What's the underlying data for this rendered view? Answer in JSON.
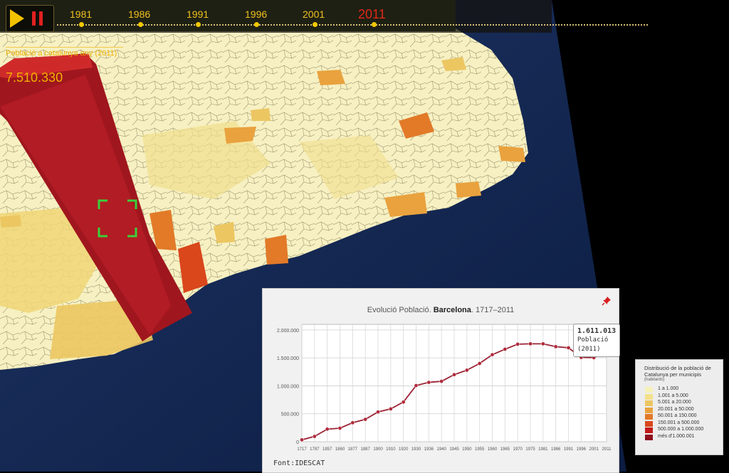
{
  "timeline": {
    "years": [
      "1981",
      "1986",
      "1991",
      "1996",
      "2001",
      "2011"
    ],
    "active_year": "2011"
  },
  "map": {
    "subtitle": "Població a catalunya any (2011)",
    "highlight_value": "7.510.330"
  },
  "chart_panel": {
    "title_prefix": "Evolució Població.",
    "title_bold": "Barcelona",
    "title_suffix": ". 1717–2011",
    "source": "Font:IDESCAT",
    "tooltip": {
      "value": "1.611.013",
      "label": "Població (2011)"
    }
  },
  "chart_data": {
    "type": "line",
    "title": "Evolució Població. Barcelona. 1717–2011",
    "categories": [
      "1717",
      "1787",
      "1857",
      "1860",
      "1877",
      "1887",
      "1900",
      "1910",
      "1920",
      "1930",
      "1936",
      "1940",
      "1945",
      "1950",
      "1955",
      "1960",
      "1965",
      "1970",
      "1975",
      "1981",
      "1986",
      "1991",
      "1996",
      "2001",
      "2011"
    ],
    "y_ticks": [
      "0",
      "500.000",
      "1.000.000",
      "1.500.000",
      "2.000.000"
    ],
    "ylim": [
      0,
      2100000
    ],
    "grid": true,
    "series": [
      {
        "values": [
          34000,
          95000,
          225000,
          242000,
          340000,
          400000,
          533000,
          587000,
          710000,
          1005000,
          1062000,
          1081000,
          1200000,
          1280000,
          1400000,
          1557000,
          1655000,
          1745000,
          1752000,
          1752000,
          1701000,
          1681000,
          1508000,
          1503000,
          1611013
        ]
      }
    ],
    "colors": {
      "line": "#9b2335",
      "marker": "#b02a3a"
    }
  },
  "legend": {
    "title": "Distribució de la població de Catalunya per municipis",
    "subtitle": "(habitants)",
    "items": [
      {
        "label": "1 a 1.000",
        "color": "#f6f0b8"
      },
      {
        "label": "1.001 a 5.000",
        "color": "#f3e08a"
      },
      {
        "label": "5.001 a 20.000",
        "color": "#ecc661"
      },
      {
        "label": "20.001 a 50.000",
        "color": "#e9a23e"
      },
      {
        "label": "50.001 a 150.000",
        "color": "#e27a28"
      },
      {
        "label": "150.001 a 500.000",
        "color": "#d9471b"
      },
      {
        "label": "500.000 a 1.000.000",
        "color": "#c21a1a"
      },
      {
        "label": "més d'1.000.001",
        "color": "#8e0f1e"
      }
    ]
  }
}
